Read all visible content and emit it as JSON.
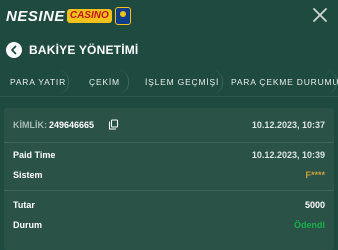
{
  "brand": {
    "name": "NESINE",
    "sub": "CASINO"
  },
  "header": {
    "title": "BAKİYE YÖNETİMİ"
  },
  "tabs": [
    {
      "label": "PARA YATIR"
    },
    {
      "label": "ÇEKİM"
    },
    {
      "label": "İŞLEM GEÇMİŞİ"
    },
    {
      "label": "PARA ÇEKME DURUMU"
    }
  ],
  "transaction": {
    "id_label": "KİMLİK:",
    "id_value": "249646665",
    "created": "10.12.2023, 10:37",
    "paid_time_label": "Paid Time",
    "paid_time_value": "10.12.2023, 10:39",
    "system_label": "Sistem",
    "system_value": "F****",
    "amount_label": "Tutar",
    "amount_value": "5000",
    "status_label": "Durum",
    "status_value": "Ödendi"
  },
  "colors": {
    "background": "#1f4a3f",
    "card": "#2a5246",
    "status_paid": "#18b04a",
    "system_masked": "#c9a23c"
  },
  "icons": [
    "close-icon",
    "back-arrow-icon",
    "copy-icon"
  ]
}
